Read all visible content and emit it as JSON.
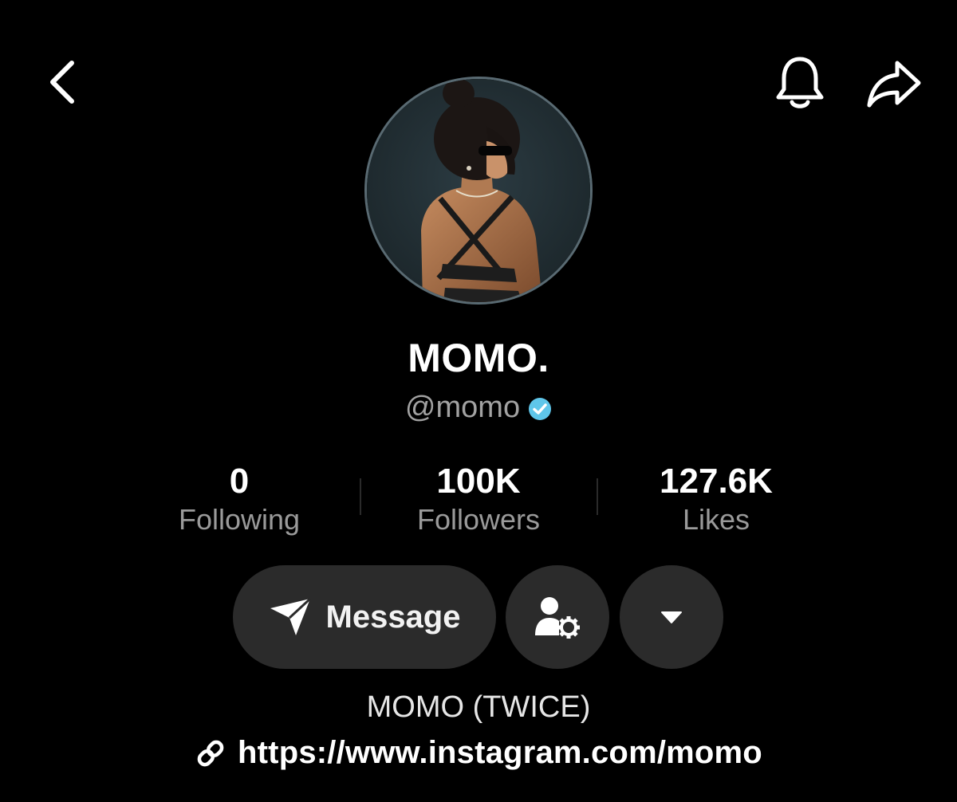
{
  "header": {
    "back_icon": "chevron-left-icon",
    "bell_icon": "bell-icon",
    "share_icon": "share-arrow-icon"
  },
  "profile": {
    "display_name": "MOMO.",
    "handle": "@momo",
    "verified": true,
    "verified_color": "#5fc6ea"
  },
  "stats": [
    {
      "value": "0",
      "label": "Following"
    },
    {
      "value": "100K",
      "label": "Followers"
    },
    {
      "value": "127.6K",
      "label": "Likes"
    }
  ],
  "actions": {
    "message_label": "Message",
    "message_icon": "paper-plane-icon",
    "friend_settings_icon": "user-gear-icon",
    "more_icon": "caret-down-icon"
  },
  "bio": {
    "text": "MOMO (TWICE)",
    "link_icon": "link-icon",
    "link": "https://www.instagram.com/momo"
  },
  "colors": {
    "background": "#000000",
    "button_bg": "#2b2b2b",
    "secondary_text": "#9a9a9a"
  }
}
